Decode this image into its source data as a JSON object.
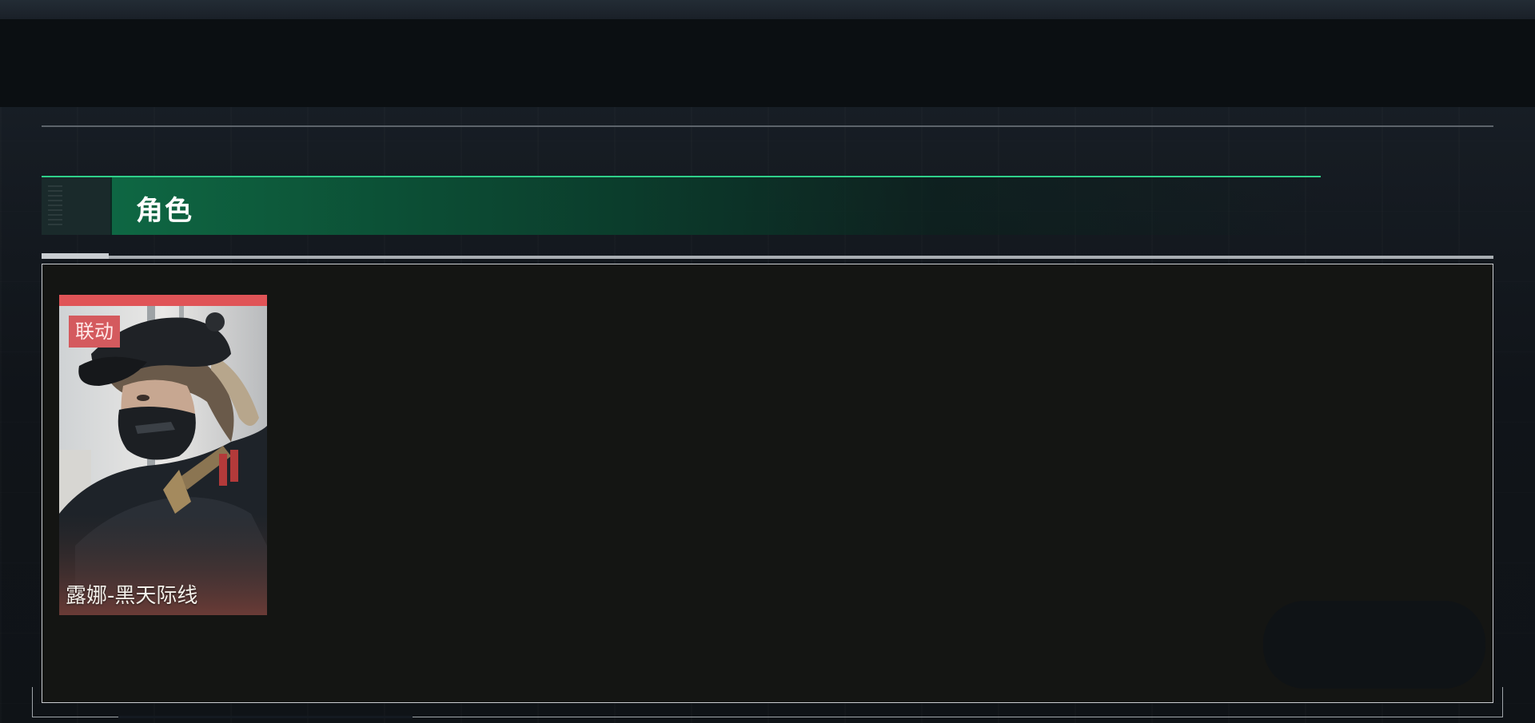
{
  "section": {
    "title": "角色"
  },
  "characters": [
    {
      "tag": "联动",
      "name": "露娜-黑天际线",
      "accent_color": "#e05457"
    }
  ],
  "colors": {
    "header_green": "#0f6d47",
    "header_line": "#2fd08a",
    "panel_bg": "#141513",
    "tag_bg": "#d45a5e"
  },
  "icons": {
    "card_art": "character-portrait-masked-soldier"
  }
}
